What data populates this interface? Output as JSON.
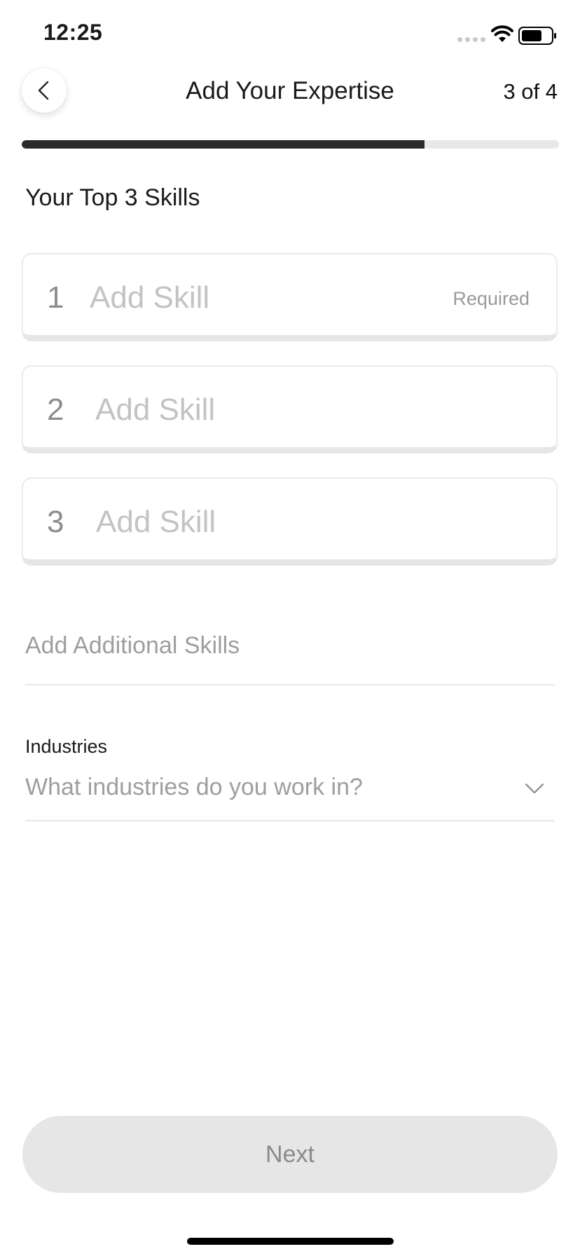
{
  "status_bar": {
    "time": "12:25",
    "icons": [
      "signal-dots-icon",
      "wifi-icon",
      "battery-icon"
    ]
  },
  "header": {
    "back_icon": "chevron-left-icon",
    "title": "Add Your Expertise",
    "step": "3 of 4"
  },
  "progress": {
    "fraction": 0.75,
    "fill_color": "#2b2b2b",
    "track_color": "#e8e8e8"
  },
  "skills_section": {
    "title": "Your Top 3 Skills",
    "items": [
      {
        "number": "1",
        "placeholder": "Add Skill",
        "required_label": "Required"
      },
      {
        "number": "2",
        "placeholder": "Add Skill"
      },
      {
        "number": "3",
        "placeholder": "Add Skill"
      }
    ]
  },
  "additional_skills": {
    "placeholder": "Add Additional Skills"
  },
  "industries": {
    "label": "Industries",
    "placeholder": "What industries do you work in?",
    "icon": "chevron-down-icon"
  },
  "footer": {
    "next_label": "Next"
  }
}
